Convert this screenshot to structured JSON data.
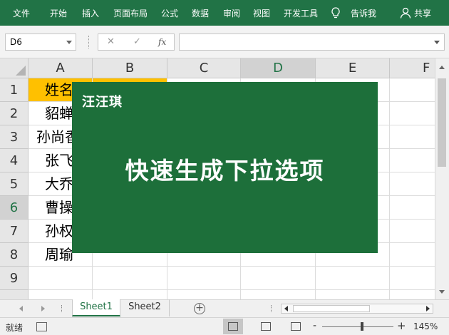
{
  "ribbon": {
    "tabs": [
      "文件",
      "开始",
      "插入",
      "页面布局",
      "公式",
      "数据",
      "审阅",
      "视图",
      "开发工具"
    ],
    "tell_me": "告诉我",
    "share": "共享",
    "bg_color": "#217346"
  },
  "formula_bar": {
    "name_box": "D6",
    "cancel_symbol": "✕",
    "enter_symbol": "✓",
    "fx_symbol": "fx",
    "formula_value": ""
  },
  "sheet": {
    "columns": [
      "A",
      "B",
      "C",
      "D",
      "E",
      "F"
    ],
    "rows": [
      "1",
      "2",
      "3",
      "4",
      "5",
      "6",
      "7",
      "8",
      "9"
    ],
    "cells": {
      "a1": "姓名",
      "a2": "貂蝉",
      "a3": "孙尚香",
      "a4": "张飞",
      "a5": "大乔",
      "a6": "曹操",
      "a7": "孙权",
      "a8": "周瑜"
    },
    "highlight_color": "#ffc000"
  },
  "overlay": {
    "author": "汪汪琪",
    "title": "快速生成下拉选项",
    "bg_color": "#1d6f3a"
  },
  "sheet_tabs": {
    "tabs": [
      "Sheet1",
      "Sheet2"
    ],
    "active": "Sheet1",
    "add_symbol": "+"
  },
  "status_bar": {
    "ready": "就绪",
    "zoom_minus": "-",
    "zoom_plus": "+",
    "zoom": "145%",
    "zoom_level_fraction": 0.54
  }
}
